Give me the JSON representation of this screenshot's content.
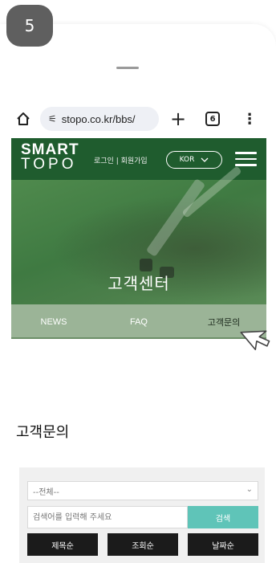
{
  "step": {
    "number": "5"
  },
  "browser": {
    "url": "stopo.co.kr/bbs/",
    "tab_count": "6",
    "more_label": "⋮",
    "new_tab_label": "+"
  },
  "site": {
    "logo_line1": "SMART",
    "logo_line2": "TOPO",
    "auth_links": "로그인 | 회원가입",
    "language": "KOR",
    "hero_title": "고객센터",
    "tabs": [
      {
        "label": "NEWS"
      },
      {
        "label": "FAQ"
      },
      {
        "label": "고객문의"
      }
    ],
    "page_heading": "고객문의",
    "search": {
      "select_value": "--전체--",
      "input_placeholder": "검색어를 입력해 주세요",
      "button_label": "검색"
    },
    "sort_buttons": [
      {
        "label": "제목순"
      },
      {
        "label": "조회순"
      },
      {
        "label": "날짜순"
      }
    ]
  },
  "colors": {
    "header_green": "#1f5c2e",
    "subnav_green": "#9bb497",
    "search_button": "#5fc4b8",
    "sort_button": "#1b1b1b"
  }
}
